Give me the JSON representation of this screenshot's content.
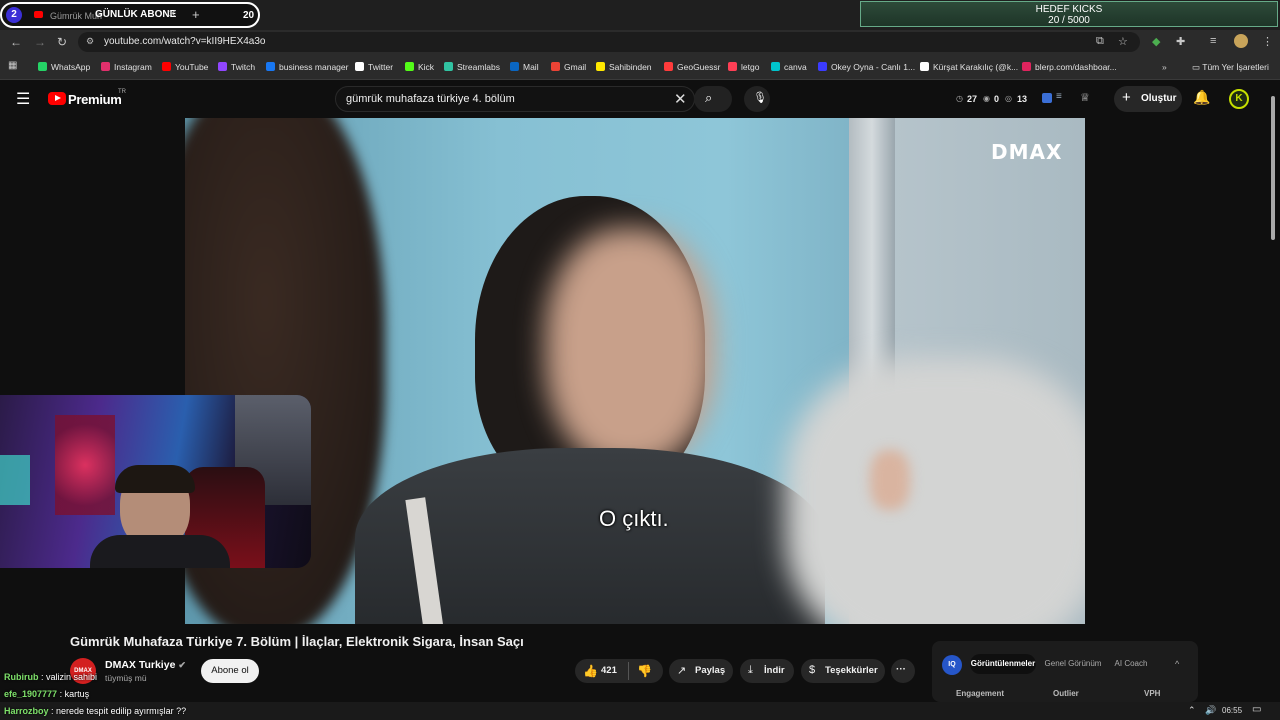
{
  "tab": {
    "number": "2",
    "title": "Gümrük Muh",
    "overlay": "GÜNLÜK ABONE",
    "close": "✕",
    "new": "+",
    "count": "20"
  },
  "goal": {
    "title": "HEDEF KICKS",
    "value": "20 / 5000"
  },
  "address": {
    "url": "youtube.com/watch?v=kII9HEX4a3o"
  },
  "bookmarks": [
    {
      "label": "WhatsApp",
      "color": "#25d366"
    },
    {
      "label": "Instagram",
      "color": "#e1306c"
    },
    {
      "label": "YouTube",
      "color": "#ff0000"
    },
    {
      "label": "Twitch",
      "color": "#9146ff"
    },
    {
      "label": "business manager",
      "color": "#1877f2"
    },
    {
      "label": "Twitter",
      "color": "#ffffff"
    },
    {
      "label": "Kick",
      "color": "#53fc18"
    },
    {
      "label": "Streamlabs",
      "color": "#31c3a2"
    },
    {
      "label": "Mail",
      "color": "#0a66c2"
    },
    {
      "label": "Gmail",
      "color": "#ea4335"
    },
    {
      "label": "Sahibinden",
      "color": "#ffe800"
    },
    {
      "label": "GeoGuessr",
      "color": "#ff3b3b"
    },
    {
      "label": "letgo",
      "color": "#ff3f55"
    },
    {
      "label": "canva",
      "color": "#00c4cc"
    },
    {
      "label": "Okey Oyna - Canlı 1...",
      "color": "#3b3bff"
    },
    {
      "label": "Kürşat Karakılıç (@k...",
      "color": "#ffffff"
    },
    {
      "label": "blerp.com/dashboar...",
      "color": "#e0245e"
    }
  ],
  "bookmarks_more": "»",
  "bookmarks_all": "Tüm Yer İşaretleri",
  "yt": {
    "brand": "Premium",
    "region": "TR",
    "search_value": "gümrük muhafaza türkiye 4. bölüm",
    "stats": [
      "27",
      "0",
      "13"
    ],
    "create_label": "Oluştur",
    "avatar_letter": "K"
  },
  "video": {
    "watermark": "DMAX",
    "subtitle": "O çıktı."
  },
  "meta": {
    "title": "Gümrük Muhafaza Türkiye 7. Bölüm | İlaçlar, Elektronik Sigara, İnsan Saçı",
    "channel_name": "DMAX Turkiye",
    "channel_avatar": "DMAX",
    "channel_sub": "tüymüş mü",
    "subscribe_label": "Abone ol",
    "likes": "421",
    "share_label": "Paylaş",
    "download_label": "İndir",
    "thanks_label": "Teşekkürler",
    "more": "···"
  },
  "iq": {
    "logo": "IQ",
    "tabs": [
      "Görüntülenmeler",
      "Genel Görünüm",
      "AI Coach"
    ],
    "collapse": "^",
    "columns": [
      "Engagement",
      "Outlier",
      "VPH"
    ]
  },
  "chat": [
    {
      "user": "Rubirub",
      "color": "#7ee06a",
      "message": "valizin sahibi"
    },
    {
      "user": "efe_1907777",
      "color": "#7ee06a",
      "message": "kartuş"
    },
    {
      "user": "Harrozboy",
      "color": "#7ee06a",
      "message": "nerede tespit edilip ayırmışlar ??"
    }
  ],
  "taskbar": {
    "time": "06:55"
  }
}
